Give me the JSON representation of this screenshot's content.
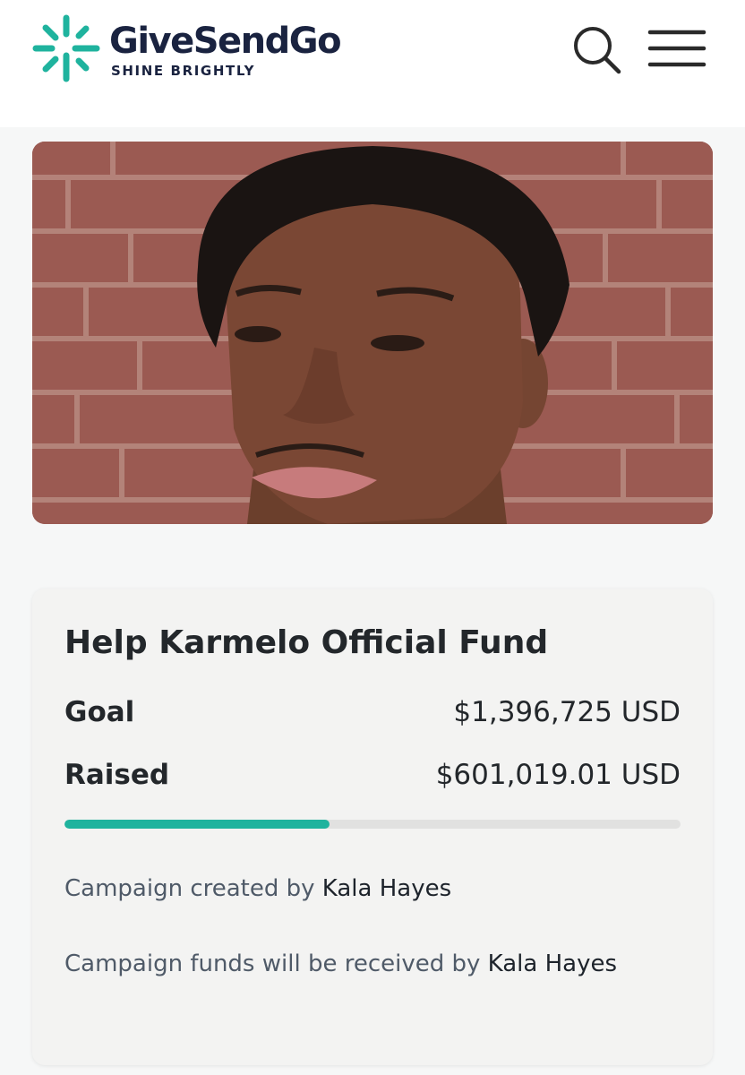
{
  "header": {
    "brand_name": "GiveSendGo",
    "tagline": "SHINE BRIGHTLY",
    "search_icon": "search-icon",
    "menu_icon": "hamburger-menu-icon",
    "brand_color": "#1fb39e",
    "brand_text_color": "#1a2340"
  },
  "campaign": {
    "title": "Help Karmelo Official Fund",
    "goal_label": "Goal",
    "goal_value": "$1,396,725 USD",
    "raised_label": "Raised",
    "raised_value": "$601,019.01 USD",
    "progress_fraction": 0.43,
    "progress_color": "#1fb39e",
    "created_by_prefix": "Campaign created by ",
    "created_by_name": "Kala Hayes",
    "received_by_prefix": "Campaign funds will be received by ",
    "received_by_name": "Kala Hayes"
  }
}
